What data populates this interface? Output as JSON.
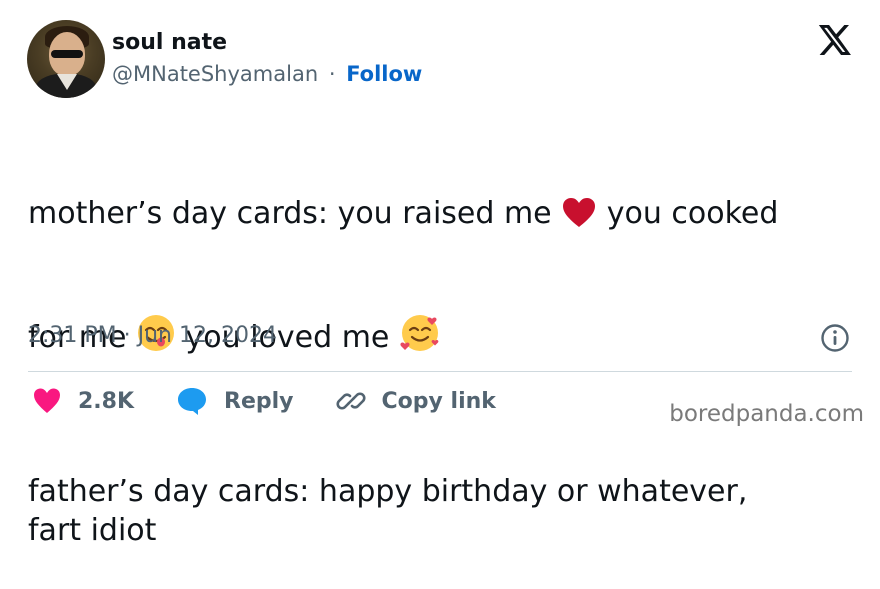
{
  "author": {
    "name": "soul nate",
    "handle": "@MNateShyamalan",
    "separator": "·",
    "follow_label": "Follow"
  },
  "tweet": {
    "line1_a": "mother’s day cards: you raised me ",
    "line1_b": " you cooked",
    "line2_a": "for me ",
    "line2_b": " you loved me ",
    "para2": "father’s day cards: happy birthday or whatever,\nfart idiot",
    "timestamp": "2:31 PM · Jun 12, 2024"
  },
  "actions": {
    "likes": "2.8K",
    "reply_label": "Reply",
    "copy_link_label": "Copy link"
  },
  "watermark": "boredpanda.com",
  "icons": {
    "x_logo": "x-logo-icon",
    "heart": "heart-icon",
    "reply": "reply-bubble-icon",
    "link": "link-icon",
    "info": "info-icon"
  },
  "colors": {
    "text": "#0f1419",
    "muted": "#536471",
    "follow": "#0866c9",
    "like": "#f91880",
    "reply": "#1d9bf0",
    "emoji_heart": "#c8102e"
  }
}
